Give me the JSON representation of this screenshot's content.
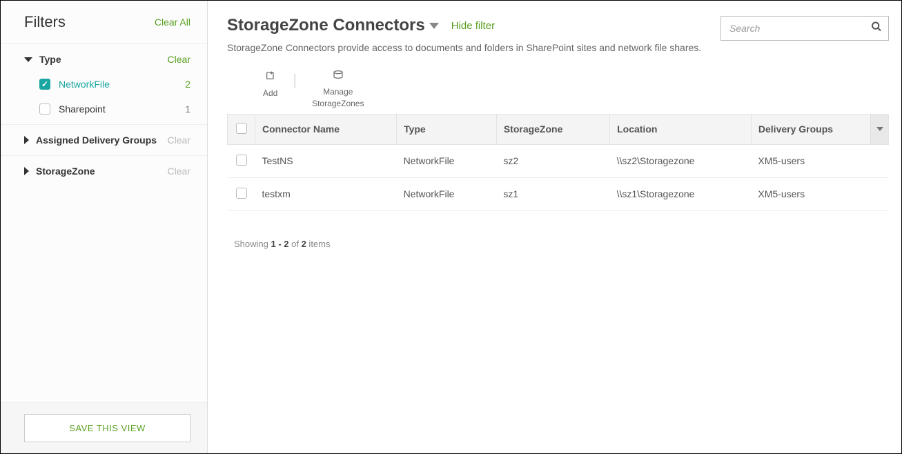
{
  "sidebar": {
    "title": "Filters",
    "clear_all": "Clear All",
    "save_view": "SAVE THIS VIEW",
    "sections": [
      {
        "label": "Type",
        "expanded": true,
        "clear_label": "Clear",
        "clear_active": true,
        "items": [
          {
            "label": "NetworkFile",
            "count": "2",
            "checked": true
          },
          {
            "label": "Sharepoint",
            "count": "1",
            "checked": false
          }
        ]
      },
      {
        "label": "Assigned Delivery Groups",
        "expanded": false,
        "clear_label": "Clear",
        "clear_active": false
      },
      {
        "label": "StorageZone",
        "expanded": false,
        "clear_label": "Clear",
        "clear_active": false
      }
    ]
  },
  "header": {
    "title": "StorageZone Connectors",
    "hide_filter": "Hide filter",
    "subtitle": "StorageZone Connectors provide access to documents and folders in SharePoint sites and network file shares."
  },
  "search": {
    "placeholder": "Search"
  },
  "toolbar": {
    "add": "Add",
    "manage_line1": "Manage",
    "manage_line2": "StorageZones"
  },
  "table": {
    "columns": [
      "Connector Name",
      "Type",
      "StorageZone",
      "Location",
      "Delivery Groups"
    ],
    "rows": [
      {
        "name": "TestNS",
        "type": "NetworkFile",
        "zone": "sz2",
        "location": "\\\\sz2\\Storagezone",
        "groups": "XM5-users"
      },
      {
        "name": "testxm",
        "type": "NetworkFile",
        "zone": "sz1",
        "location": "\\\\sz1\\Storagezone",
        "groups": "XM5-users"
      }
    ]
  },
  "paging": {
    "prefix": "Showing ",
    "range": "1 - 2",
    "mid": " of ",
    "total": "2",
    "suffix": " items"
  }
}
